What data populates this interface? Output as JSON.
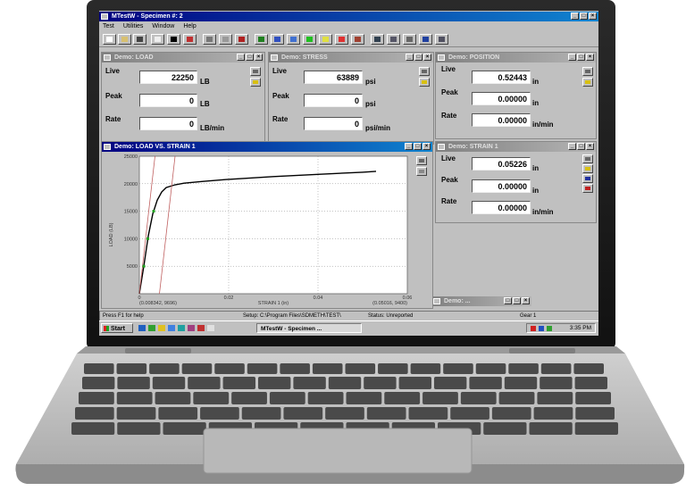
{
  "app": {
    "title": "MTestW - Specimen #: 2",
    "menu": [
      "Test",
      "Utilities",
      "Window",
      "Help"
    ]
  },
  "toolbar": {
    "buttons": [
      "new-icon",
      "open-icon",
      "save-icon",
      "page-icon",
      "crosshair-icon",
      "chart-line-icon",
      "copy-icon",
      "print-icon",
      "stop-icon",
      "green-square-icon",
      "monitor-icon",
      "up-arrow-icon",
      "green-arrow-icon",
      "yellow-icon",
      "fos-icon",
      "ramp-icon",
      "camera-icon",
      "keyboard-icon",
      "tools-icon",
      "help-icon",
      "cursor-icon"
    ]
  },
  "panels": {
    "load": {
      "title": "Demo: LOAD",
      "rows": [
        {
          "label": "Live",
          "value": "22250",
          "unit": "LB"
        },
        {
          "label": "Peak",
          "value": "0",
          "unit": "LB"
        },
        {
          "label": "Rate",
          "value": "0",
          "unit": "LB/min"
        }
      ]
    },
    "stress": {
      "title": "Demo: STRESS",
      "rows": [
        {
          "label": "Live",
          "value": "63889",
          "unit": "psi"
        },
        {
          "label": "Peak",
          "value": "0",
          "unit": "psi"
        },
        {
          "label": "Rate",
          "value": "0",
          "unit": "psi/min"
        }
      ]
    },
    "position": {
      "title": "Demo: POSITION",
      "rows": [
        {
          "label": "Live",
          "value": "0.52443",
          "unit": "in"
        },
        {
          "label": "Peak",
          "value": "0.00000",
          "unit": "in"
        },
        {
          "label": "Rate",
          "value": "0.00000",
          "unit": "in/min"
        }
      ]
    },
    "strain": {
      "title": "Demo: STRAIN 1",
      "rows": [
        {
          "label": "Live",
          "value": "0.05226",
          "unit": "in"
        },
        {
          "label": "Peak",
          "value": "0.00000",
          "unit": "in"
        },
        {
          "label": "Rate",
          "value": "0.00000",
          "unit": "in/min"
        }
      ]
    },
    "mini": {
      "title": "Demo: ..."
    }
  },
  "chart_window": {
    "title": "Demo: LOAD VS. STRAIN 1"
  },
  "chart_data": {
    "type": "line",
    "title": "",
    "xlabel": "STRAIN 1 (in)",
    "ylabel": "LOAD (LB)",
    "xlim": [
      0.0,
      0.06
    ],
    "ylim": [
      0,
      25000
    ],
    "xticks": [
      "0",
      "0.02",
      "0.04",
      "0.06"
    ],
    "yticks": [
      "5000",
      "10000",
      "15000",
      "20000",
      "25000"
    ],
    "corner_labels": {
      "left": "(0.008342, 9696)",
      "right": "(0.05016, 9400)"
    },
    "grid": true,
    "series": [
      {
        "x": [
          0.0,
          0.001,
          0.002,
          0.003,
          0.004,
          0.005,
          0.006,
          0.008,
          0.01,
          0.014,
          0.02,
          0.03,
          0.04,
          0.05,
          0.053
        ],
        "y": [
          0,
          5000,
          10500,
          14500,
          17000,
          18500,
          19300,
          19800,
          20100,
          20400,
          20800,
          21300,
          21700,
          22100,
          22250
        ],
        "color": "#000000"
      },
      {
        "x": [
          0.0,
          0.0035
        ],
        "y": [
          0,
          25000
        ],
        "color": "#c06060"
      },
      {
        "x": [
          0.0045,
          0.008
        ],
        "y": [
          0,
          25000
        ],
        "color": "#c06060"
      }
    ]
  },
  "status": {
    "help": "Press F1 for help",
    "setup": "Setup: C:\\Program Files\\SDMETH\\TEST\\",
    "state": "Status: Unreported",
    "gear": "Gear 1"
  },
  "taskbar": {
    "start": "Start",
    "task": "MTestW - Specimen ...",
    "clock": "3:35 PM"
  }
}
